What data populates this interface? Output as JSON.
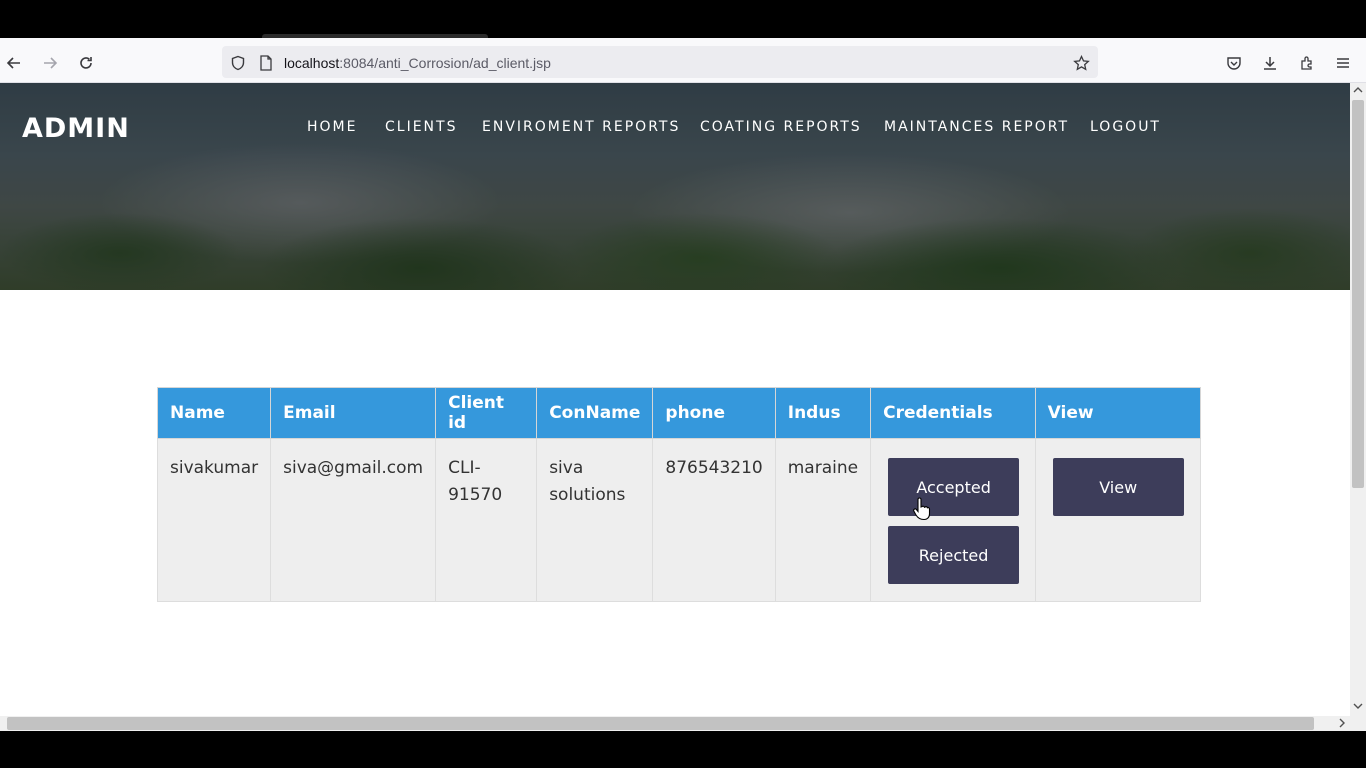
{
  "browser": {
    "url_host": "localhost",
    "url_rest": ":8084/anti_Corrosion/ad_client.jsp"
  },
  "header": {
    "brand": "ADMIN",
    "menu": [
      "HOME",
      "CLIENTS",
      "ENVIROMENT REPORTS",
      "COATING REPORTS",
      "MAINTANCES REPORT",
      "LOGOUT"
    ]
  },
  "table": {
    "headers": [
      "Name",
      "Email",
      "Client id",
      "ConName",
      "phone",
      "Indus",
      "Credentials",
      "View"
    ],
    "rows": [
      {
        "name": "sivakumar",
        "email": "siva@gmail.com",
        "client_id": "CLI-91570",
        "con_name": "siva solutions",
        "phone": "876543210",
        "indus": "maraine",
        "accepted_label": "Accepted",
        "rejected_label": "Rejected",
        "view_label": "View"
      }
    ]
  },
  "colors": {
    "table_header": "#3598dc",
    "button": "#3d3d5a"
  }
}
